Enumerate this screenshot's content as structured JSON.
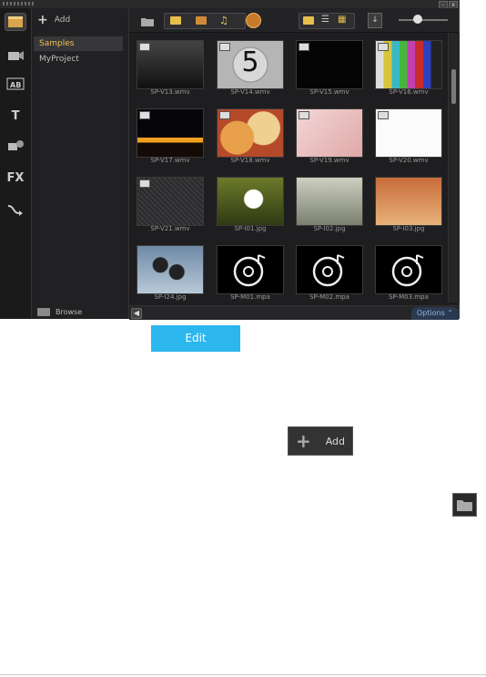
{
  "window": {
    "minimize": "-",
    "close": "x"
  },
  "folder_panel": {
    "add_label": "Add",
    "items": [
      {
        "label": "Samples",
        "selected": true
      },
      {
        "label": "MyProject",
        "selected": false
      }
    ],
    "browse_label": "Browse"
  },
  "side_tabs": [
    {
      "name": "media"
    },
    {
      "name": "instant-project"
    },
    {
      "name": "transition"
    },
    {
      "name": "title",
      "glyph": "T"
    },
    {
      "name": "graphic"
    },
    {
      "name": "filter",
      "glyph": "FX"
    },
    {
      "name": "path"
    }
  ],
  "media": [
    {
      "name": "SP-V13.wmv",
      "kind": "video"
    },
    {
      "name": "SP-V14.wmv",
      "kind": "video"
    },
    {
      "name": "SP-V15.wmv",
      "kind": "video"
    },
    {
      "name": "SP-V16.wmv",
      "kind": "video"
    },
    {
      "name": "SP-V17.wmv",
      "kind": "video"
    },
    {
      "name": "SP-V18.wmv",
      "kind": "video"
    },
    {
      "name": "SP-V19.wmv",
      "kind": "video"
    },
    {
      "name": "SP-V20.wmv",
      "kind": "video"
    },
    {
      "name": "SP-V21.wmv",
      "kind": "video"
    },
    {
      "name": "SP-I01.jpg",
      "kind": "image"
    },
    {
      "name": "SP-I02.jpg",
      "kind": "image"
    },
    {
      "name": "SP-I03.jpg",
      "kind": "image"
    },
    {
      "name": "SP-I24.jpg",
      "kind": "image"
    },
    {
      "name": "SP-M01.mpa",
      "kind": "audio"
    },
    {
      "name": "SP-M02.mpa",
      "kind": "audio"
    },
    {
      "name": "SP-M03.mpa",
      "kind": "audio"
    }
  ],
  "countdown_digit": "5",
  "bottom": {
    "options_label": "Options"
  },
  "callouts": {
    "edit_label": "Edit",
    "add_label": "Add"
  }
}
